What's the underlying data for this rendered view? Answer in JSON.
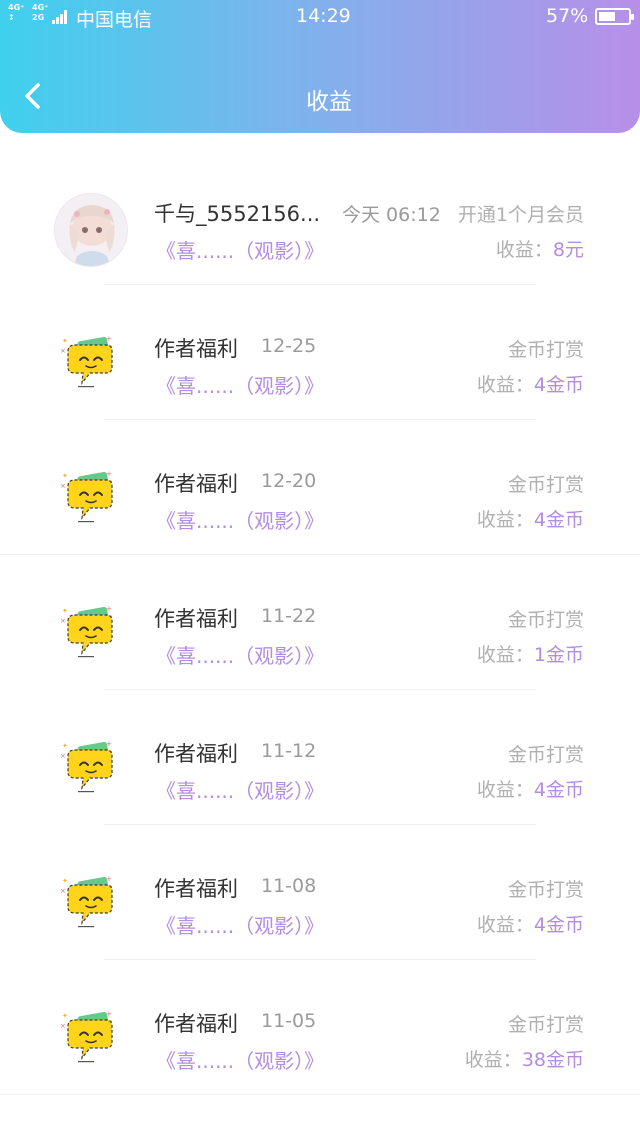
{
  "status_bar": {
    "network1": "4G⁺",
    "network1b": "↕",
    "network2": "4G⁺",
    "network2b": "2G",
    "carrier": "中国电信",
    "time": "14:29",
    "battery": "57%",
    "battery_level": 0.57
  },
  "header": {
    "title": "收益",
    "back_icon": "chevron-left-icon"
  },
  "colors": {
    "gradient_start": "#3fd0ee",
    "gradient_end": "#b78fe8",
    "accent_purple": "#b38de0"
  },
  "items": [
    {
      "name": "千与_5552156...",
      "date": "今天 06:12",
      "book": "《喜......（观影）》",
      "type": "开通1个月会员",
      "income_label": "收益：",
      "income_value": "8元",
      "icon": "user-avatar"
    },
    {
      "name": "作者福利",
      "date": "12-25",
      "book": "《喜......（观影）》",
      "type": "金币打赏",
      "income_label": "收益：",
      "income_value": "4金币",
      "icon": "speech-bubble-icon"
    },
    {
      "name": "作者福利",
      "date": "12-20",
      "book": "《喜......（观影）》",
      "type": "金币打赏",
      "income_label": "收益：",
      "income_value": "4金币",
      "icon": "speech-bubble-icon"
    },
    {
      "name": "作者福利",
      "date": "11-22",
      "book": "《喜......（观影）》",
      "type": "金币打赏",
      "income_label": "收益：",
      "income_value": "1金币",
      "icon": "speech-bubble-icon"
    },
    {
      "name": "作者福利",
      "date": "11-12",
      "book": "《喜......（观影）》",
      "type": "金币打赏",
      "income_label": "收益：",
      "income_value": "4金币",
      "icon": "speech-bubble-icon"
    },
    {
      "name": "作者福利",
      "date": "11-08",
      "book": "《喜......（观影）》",
      "type": "金币打赏",
      "income_label": "收益：",
      "income_value": "4金币",
      "icon": "speech-bubble-icon"
    },
    {
      "name": "作者福利",
      "date": "11-05",
      "book": "《喜......（观影）》",
      "type": "金币打赏",
      "income_label": "收益：",
      "income_value": "38金币",
      "icon": "speech-bubble-icon"
    }
  ]
}
